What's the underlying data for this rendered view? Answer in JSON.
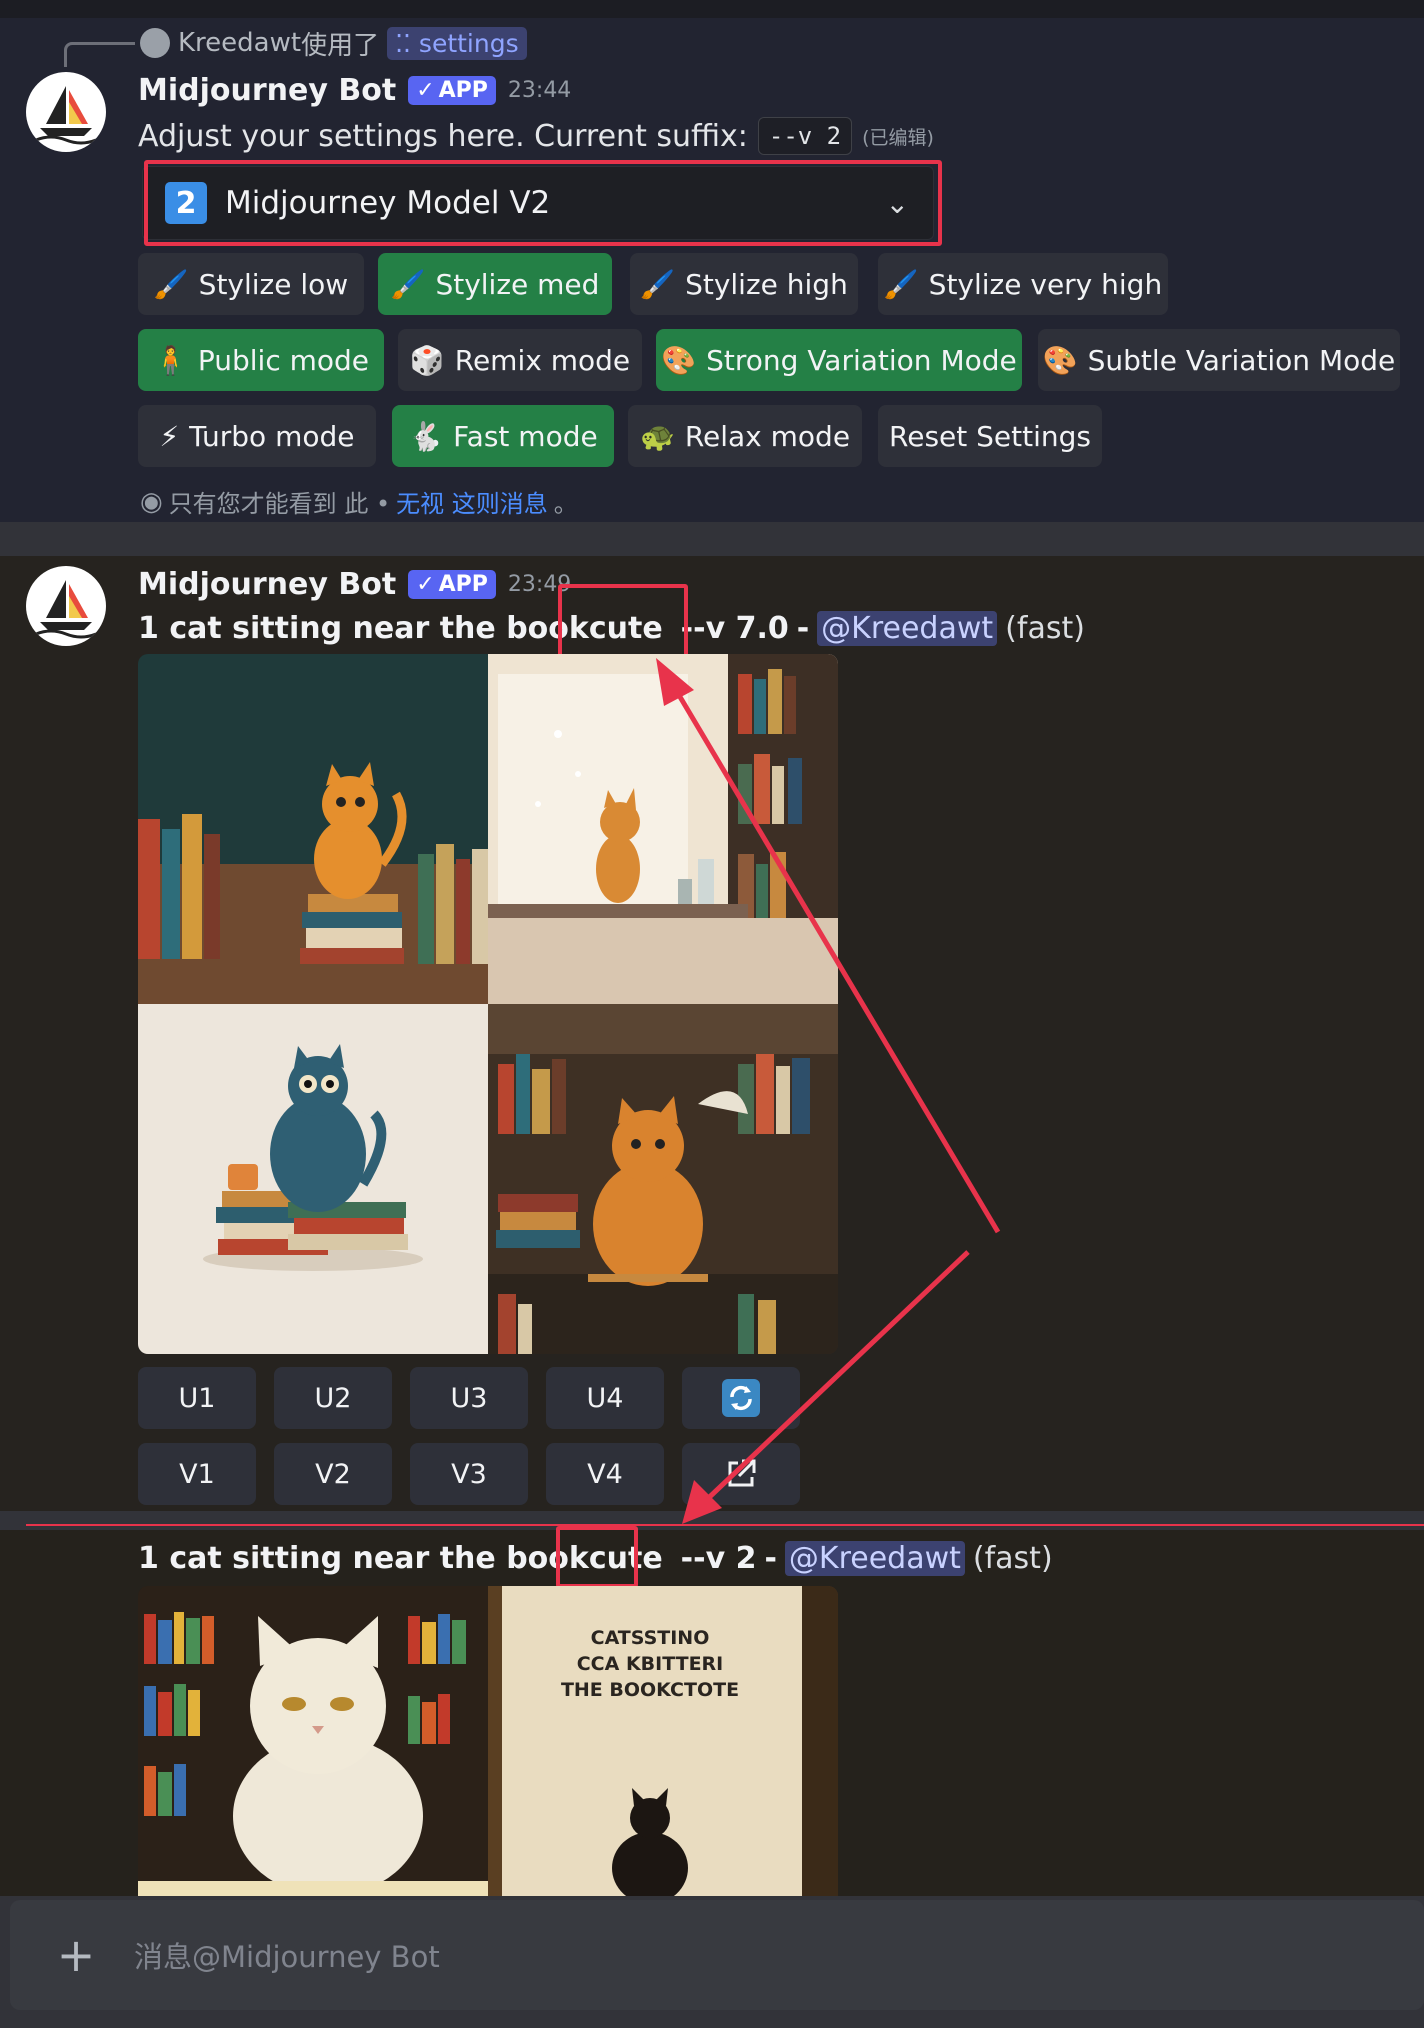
{
  "reply": {
    "user": "Kreedawt",
    "action": "使用了",
    "command": "settings"
  },
  "bot": {
    "name": "Midjourney Bot",
    "badge": "APP"
  },
  "msg1": {
    "time": "23:44",
    "text": "Adjust your settings here. Current suffix:",
    "suffix": "--v  2",
    "edited": "(已编辑)",
    "select": {
      "number": "2",
      "label": "Midjourney Model V2"
    },
    "rows": [
      [
        {
          "label": "Stylize low",
          "icon": "paintbrush-icon",
          "active": false
        },
        {
          "label": "Stylize med",
          "icon": "paintbrush-icon",
          "active": true
        },
        {
          "label": "Stylize high",
          "icon": "paintbrush-icon",
          "active": false
        },
        {
          "label": "Stylize very high",
          "icon": "paintbrush-icon",
          "active": false
        }
      ],
      [
        {
          "label": "Public mode",
          "icon": "person-icon",
          "active": true
        },
        {
          "label": "Remix mode",
          "icon": "dice-icon",
          "active": false
        },
        {
          "label": "Strong Variation Mode",
          "icon": "palette-icon",
          "active": true
        },
        {
          "label": "Subtle Variation Mode",
          "icon": "palette-icon",
          "active": false
        }
      ],
      [
        {
          "label": "Turbo mode",
          "icon": "lightning-icon",
          "active": false
        },
        {
          "label": "Fast mode",
          "icon": "rabbit-icon",
          "active": true
        },
        {
          "label": "Relax mode",
          "icon": "turtle-icon",
          "active": false
        },
        {
          "label": "Reset Settings",
          "icon": "",
          "active": false
        }
      ]
    ],
    "only_you_text": "只有您才能看到 此 • ",
    "dismiss_link": "无视 这则消息",
    "dismiss_tail": "。"
  },
  "msg2": {
    "time": "23:49",
    "prompt": "1 cat sitting near the bookcute",
    "version": "--v 7.0",
    "dash": "-",
    "mention": "@Kreedawt",
    "speed": "(fast)",
    "upscale": [
      "U1",
      "U2",
      "U3",
      "U4"
    ],
    "variation": [
      "V1",
      "V2",
      "V3",
      "V4"
    ]
  },
  "msg3": {
    "prompt": "1 cat sitting near the bookcute",
    "version": "--v 2",
    "dash": "-",
    "mention": "@Kreedawt",
    "speed": "(fast)",
    "poster_text": [
      "CATSSTINO",
      "CCA KBITTERI",
      "THE BOOKCTOTE"
    ]
  },
  "composer": {
    "placeholder": "消息@Midjourney Bot"
  },
  "colors": {
    "accent_red": "#e8334b",
    "green": "#248046",
    "blurple": "#5865f2"
  }
}
